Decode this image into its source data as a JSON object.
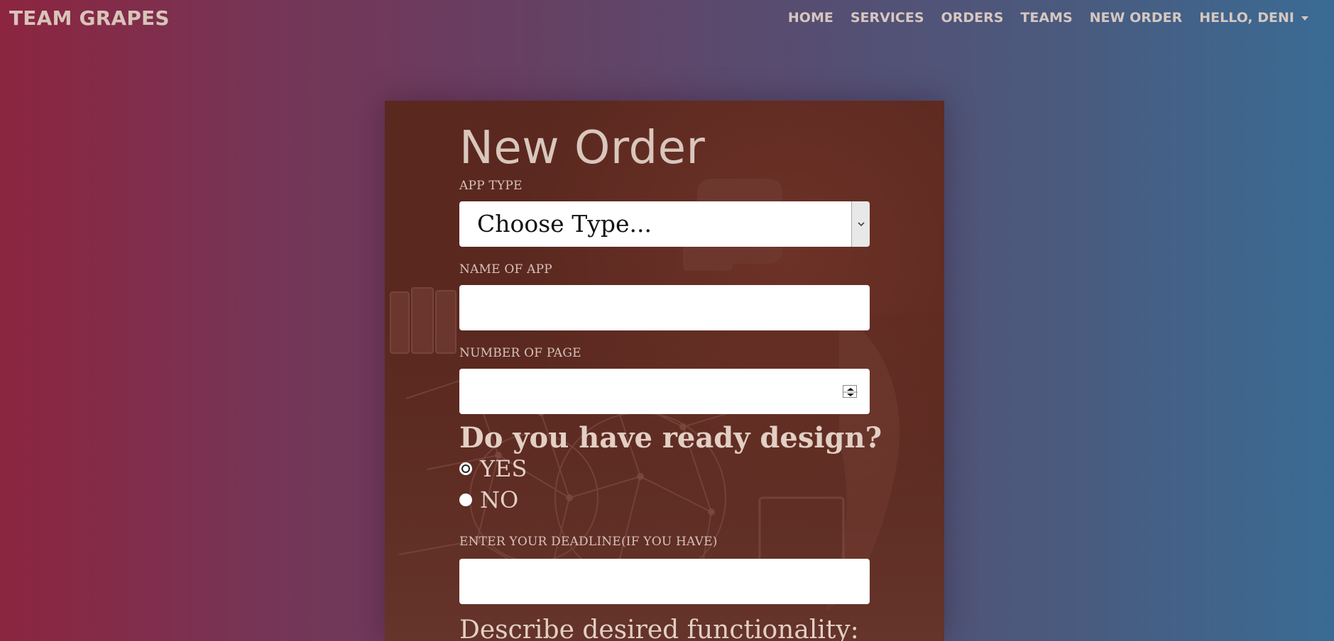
{
  "navbar": {
    "brand": "TEAM GRAPES",
    "items": [
      "HOME",
      "SERVICES",
      "ORDERS",
      "TEAMS",
      "NEW ORDER"
    ],
    "user_menu": "HELLO, DENI"
  },
  "form": {
    "title": "New Order",
    "app_type_label": "APP TYPE",
    "app_type_selected": "Choose Type...",
    "name_label": "NAME OF APP",
    "name_value": "",
    "pages_label": "NUMBER OF PAGE",
    "pages_value": "",
    "design_question": "Do you have ready design?",
    "design_options": [
      "YES",
      "NO"
    ],
    "design_selected": "YES",
    "deadline_label": "ENTER YOUR DEADLINE(IF YOU HAVE)",
    "deadline_value": "",
    "functionality_label": "Describe desired functionality:"
  },
  "colors": {
    "gradient_left": "#8c2540",
    "gradient_right": "#3a6b94",
    "card_bg": "#5e2a22",
    "text_light": "#d9c6bc"
  }
}
